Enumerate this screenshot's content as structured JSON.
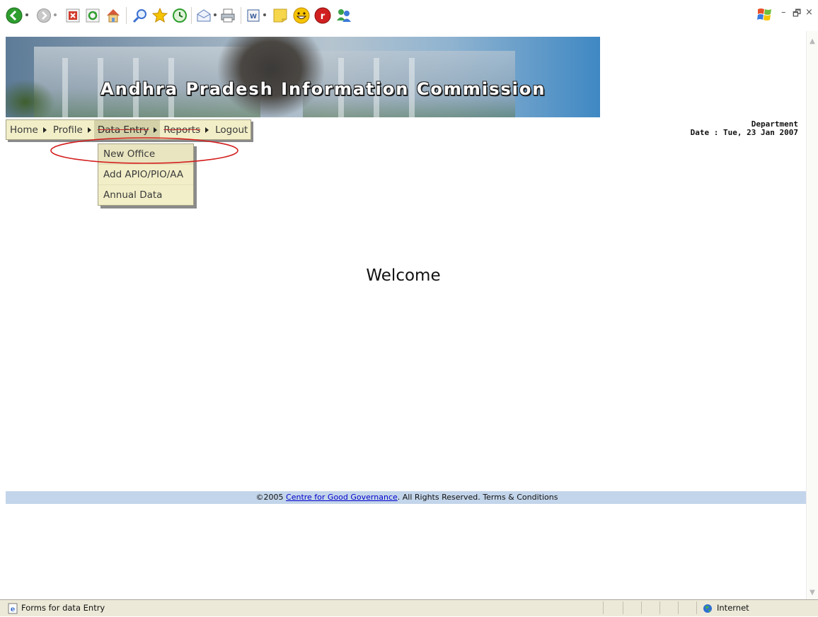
{
  "toolbar": {
    "buttons": [
      {
        "name": "back-icon",
        "color": "#2e9e2e"
      },
      {
        "name": "forward-icon",
        "color": "#9a9a9a"
      },
      {
        "name": "stop-icon",
        "color": "#d23a2a"
      },
      {
        "name": "refresh-icon",
        "color": "#2e9e2e"
      },
      {
        "name": "home-icon",
        "color": "#e9b24b"
      },
      {
        "name": "search-icon",
        "color": "#3a6fcf"
      },
      {
        "name": "favorites-icon",
        "color": "#f5c400"
      },
      {
        "name": "history-icon",
        "color": "#2e9e2e"
      },
      {
        "name": "mail-icon",
        "color": "#5a7bb5"
      },
      {
        "name": "print-icon",
        "color": "#7a7a7a"
      },
      {
        "name": "edit-icon",
        "color": "#3b5e9e"
      },
      {
        "name": "notes-icon",
        "color": "#f6d64a"
      },
      {
        "name": "messenger-smiley-icon",
        "color": "#f5c400"
      },
      {
        "name": "r-icon",
        "color": "#d12020"
      },
      {
        "name": "contacts-icon",
        "color": "#3ba04a"
      }
    ],
    "window_controls": {
      "minimize": "–",
      "restore": "🗗",
      "close": "×"
    }
  },
  "banner": {
    "title": "Andhra Pradesh Information Commission"
  },
  "nav": {
    "items": [
      {
        "label": "Home"
      },
      {
        "label": "Profile"
      },
      {
        "label": "Data Entry"
      },
      {
        "label": "Reports"
      },
      {
        "label": "Logout"
      }
    ]
  },
  "dropdown": {
    "items": [
      {
        "label": "New Office"
      },
      {
        "label": "Add APIO/PIO/AA"
      },
      {
        "label": "Annual Data"
      }
    ]
  },
  "header_info": {
    "department": "Department",
    "date": "Date : Tue, 23 Jan 2007"
  },
  "main": {
    "welcome": "Welcome"
  },
  "footer": {
    "copyright": "©2005 ",
    "link_text": "Centre for Good Governance",
    "rest": ". All Rights Reserved. Terms & Conditions"
  },
  "statusbar": {
    "text": "Forms for data Entry",
    "zone": "Internet"
  },
  "colors": {
    "menu_bg": "#f2efc8",
    "footer_bg": "#c3d5ea",
    "highlight_ellipse": "#d42020"
  }
}
